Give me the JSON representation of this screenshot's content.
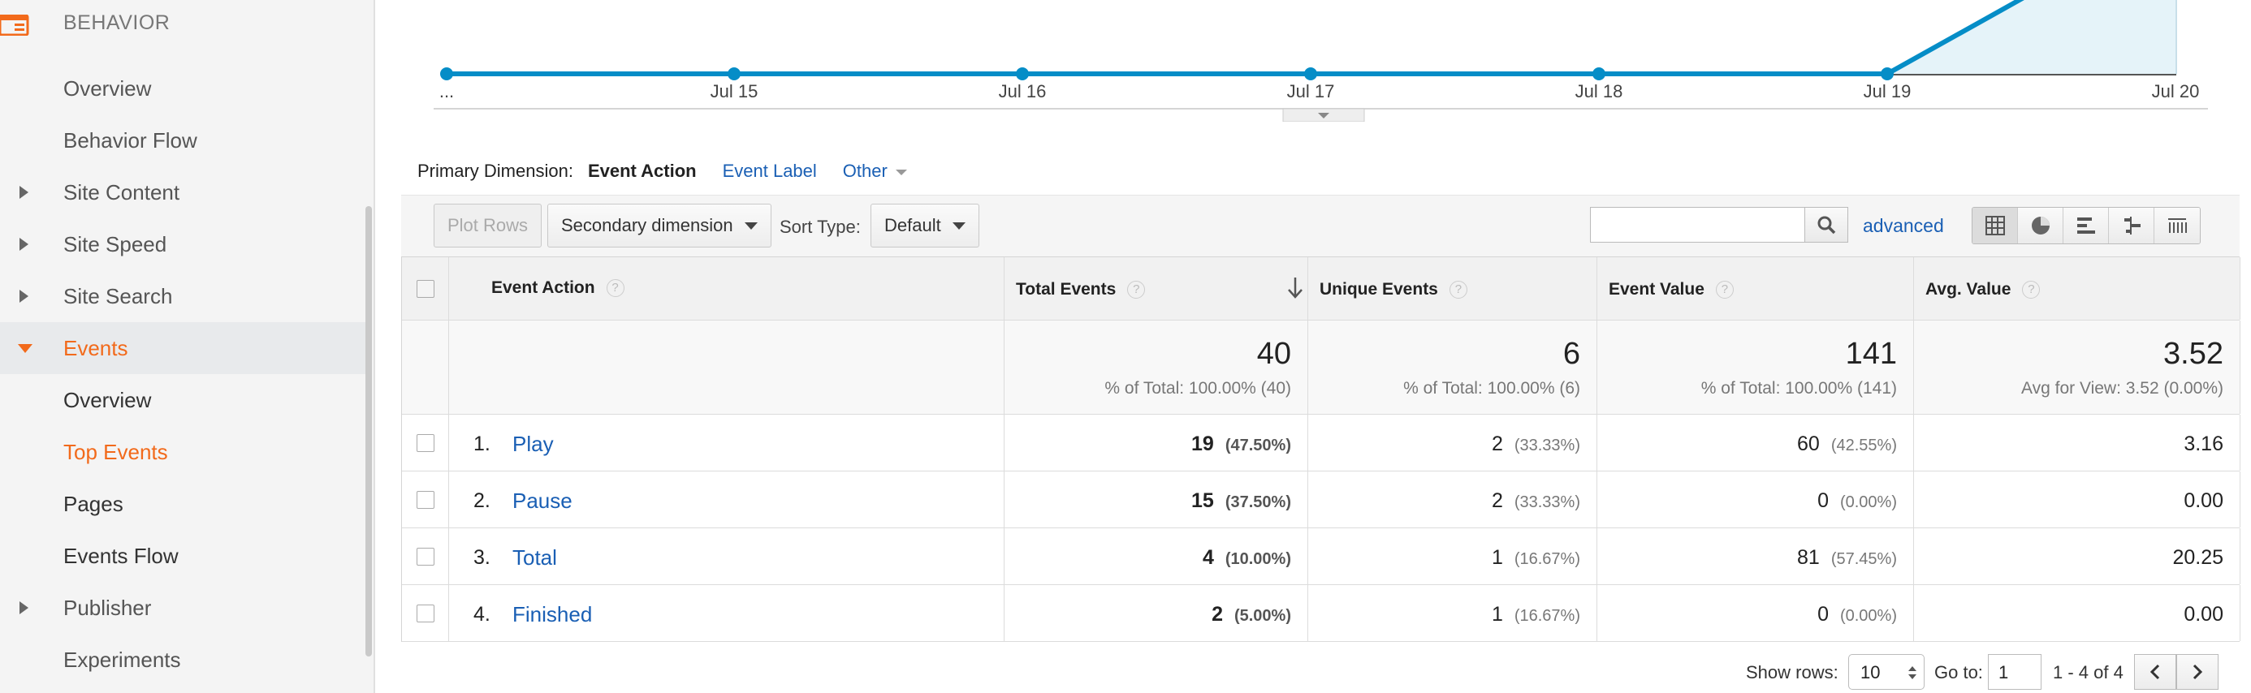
{
  "sidebar": {
    "section_title": "BEHAVIOR",
    "items": [
      {
        "label": "Overview"
      },
      {
        "label": "Behavior Flow"
      },
      {
        "label": "Site Content"
      },
      {
        "label": "Site Speed"
      },
      {
        "label": "Site Search"
      },
      {
        "label": "Events"
      },
      {
        "label": "Overview"
      },
      {
        "label": "Top Events"
      },
      {
        "label": "Pages"
      },
      {
        "label": "Events Flow"
      },
      {
        "label": "Publisher"
      },
      {
        "label": "Experiments"
      }
    ]
  },
  "timeline": {
    "start_label": "...",
    "ticks": [
      "Jul 15",
      "Jul 16",
      "Jul 17",
      "Jul 18",
      "Jul 19",
      "Jul 20"
    ],
    "line_color": "#058dc7",
    "fill_color": "#e5f3f9"
  },
  "primary_dimension": {
    "label": "Primary Dimension:",
    "active": "Event Action",
    "options": [
      "Event Label",
      "Other"
    ]
  },
  "toolbar": {
    "plot_rows": "Plot Rows",
    "secondary_dimension": "Secondary dimension",
    "sort_type_label": "Sort Type:",
    "sort_type_value": "Default",
    "search_placeholder": "",
    "advanced": "advanced",
    "view_icons": [
      "table-view-icon",
      "pie-view-icon",
      "bar-view-icon",
      "comparison-view-icon",
      "pivot-view-icon"
    ]
  },
  "table": {
    "headers": {
      "dimension": "Event Action",
      "total_events": "Total Events",
      "unique_events": "Unique Events",
      "event_value": "Event Value",
      "avg_value": "Avg. Value",
      "help": "?"
    },
    "totals": {
      "total_events": "40",
      "total_events_sub": "% of Total: 100.00% (40)",
      "unique_events": "6",
      "unique_events_sub": "% of Total: 100.00% (6)",
      "event_value": "141",
      "event_value_sub": "% of Total: 100.00% (141)",
      "avg_value": "3.52",
      "avg_value_sub": "Avg for View: 3.52 (0.00%)"
    },
    "rows": [
      {
        "num": "1.",
        "name": "Play",
        "total_events": "19",
        "total_events_pct": "(47.50%)",
        "unique_events": "2",
        "unique_events_pct": "(33.33%)",
        "event_value": "60",
        "event_value_pct": "(42.55%)",
        "avg_value": "3.16"
      },
      {
        "num": "2.",
        "name": "Pause",
        "total_events": "15",
        "total_events_pct": "(37.50%)",
        "unique_events": "2",
        "unique_events_pct": "(33.33%)",
        "event_value": "0",
        "event_value_pct": "(0.00%)",
        "avg_value": "0.00"
      },
      {
        "num": "3.",
        "name": "Total",
        "total_events": "4",
        "total_events_pct": "(10.00%)",
        "unique_events": "1",
        "unique_events_pct": "(16.67%)",
        "event_value": "81",
        "event_value_pct": "(57.45%)",
        "avg_value": "20.25"
      },
      {
        "num": "4.",
        "name": "Finished",
        "total_events": "2",
        "total_events_pct": "(5.00%)",
        "unique_events": "1",
        "unique_events_pct": "(16.67%)",
        "event_value": "0",
        "event_value_pct": "(0.00%)",
        "avg_value": "0.00"
      }
    ]
  },
  "footer": {
    "show_rows_label": "Show rows:",
    "show_rows_value": "10",
    "goto_label": "Go to:",
    "goto_value": "1",
    "range": "1 - 4 of 4"
  },
  "colors": {
    "accent_orange": "#f26a1b",
    "link_blue": "#1a5fb4"
  }
}
